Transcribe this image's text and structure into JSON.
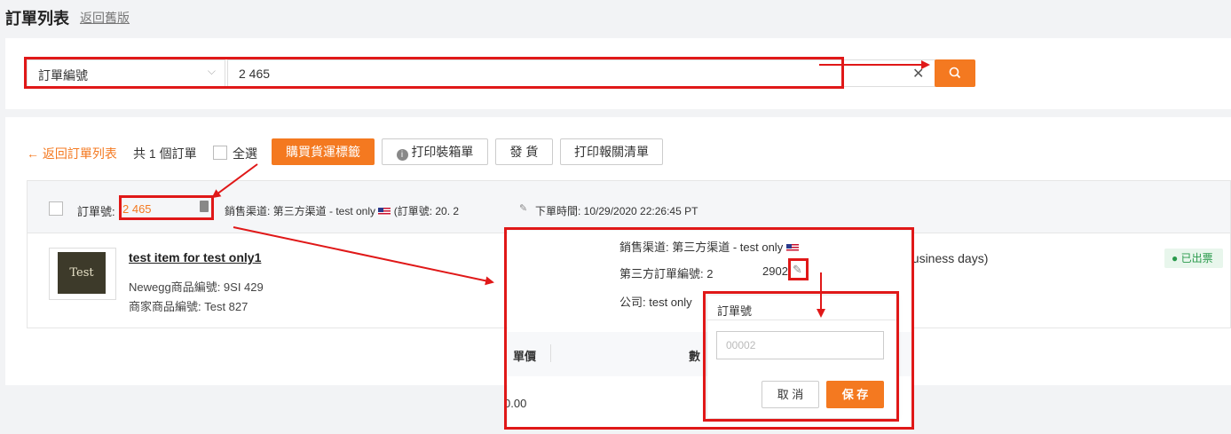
{
  "header": {
    "title": "訂單列表",
    "back_link": "返回舊版"
  },
  "search": {
    "field_label": "訂單編號",
    "value": "2          465",
    "clear_icon": "close-icon",
    "button_icon": "search-icon"
  },
  "toolbar": {
    "back_label": "← 返回訂單列表",
    "count_text": "共 1 個訂單",
    "select_all": "全選",
    "buy_label": "購買貨運標籤",
    "pack_label": "打印裝箱單",
    "ship_label": "發 貨",
    "customs_label": "打印報關清單"
  },
  "order": {
    "no_label": "訂單號:",
    "no_value": "2       465",
    "channel_text": "銷售渠道: 第三方渠道 - test only",
    "third_no_text": "(訂單號: 20.           2",
    "time_text": "下單時間:  10/29/2020 22:26:45 PT"
  },
  "item": {
    "thumb_text": "Test",
    "title": "test item  for test only1",
    "newegg_no": "Newegg商品編號: 9SI             429",
    "seller_no": "商家商品編號: Test             827",
    "business_days": "business days)",
    "status": "● 已出票"
  },
  "detail": {
    "channel": "銷售渠道: 第三方渠道 - test only",
    "third_label": "第三方訂單編號: 2",
    "third_value": "2902",
    "company": "公司: test only",
    "th_price": "單價",
    "th_qty": "數",
    "price_value": "0.00"
  },
  "edit_popup": {
    "title": "訂單號",
    "input_value": "            00002",
    "cancel_label": "取 消",
    "save_label": "保 存"
  },
  "colors": {
    "accent": "#f47920",
    "annotation": "#e01818",
    "success": "#2a9a4c"
  }
}
